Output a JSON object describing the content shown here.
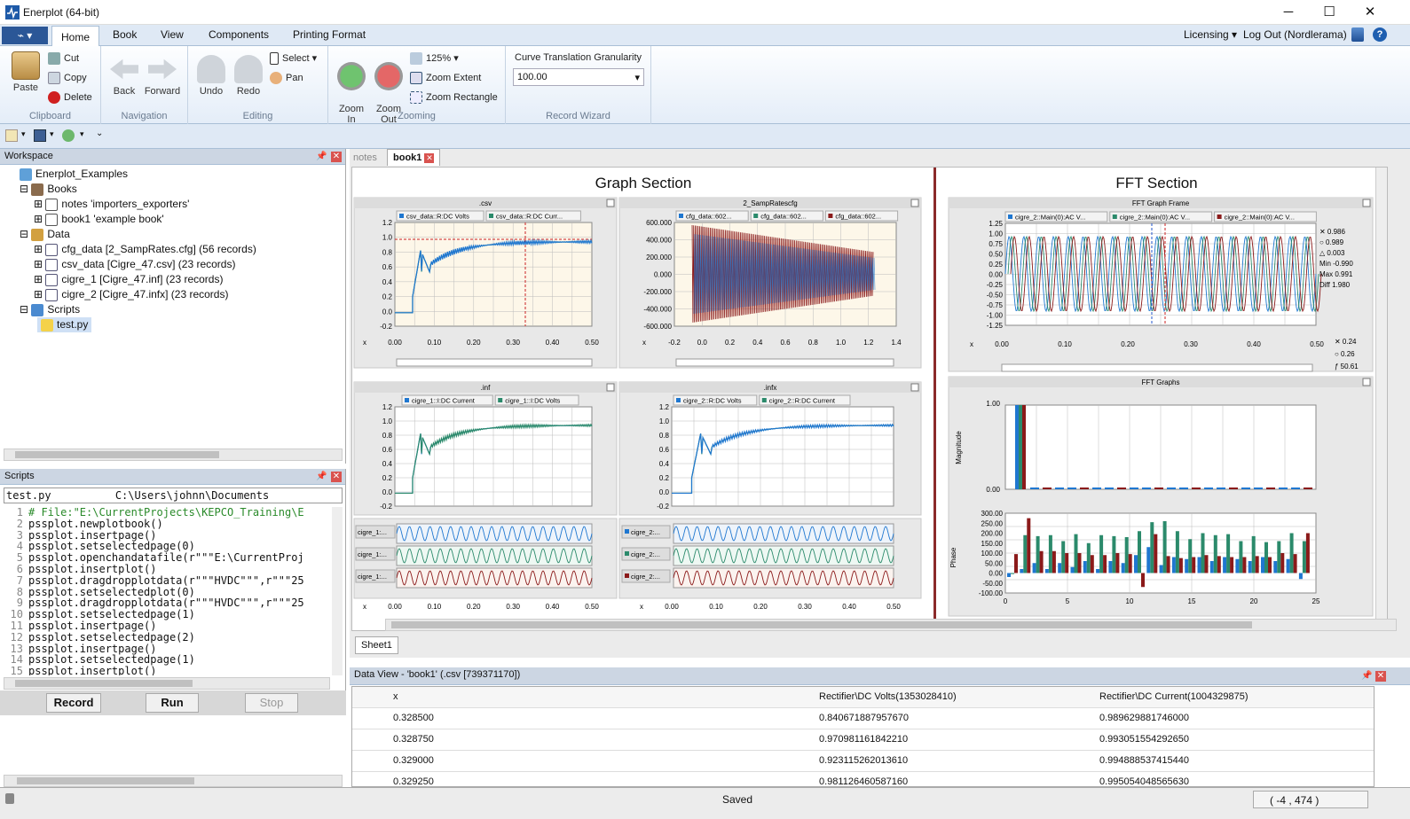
{
  "window": {
    "title": "Enerplot (64-bit)"
  },
  "ribbon": {
    "tabs": [
      "Home",
      "Book",
      "View",
      "Components",
      "Printing Format"
    ],
    "right": {
      "licensing": "Licensing",
      "logout": "Log Out (Nordlerama)"
    },
    "clipboard": {
      "paste": "Paste",
      "cut": "Cut",
      "copy": "Copy",
      "delete": "Delete",
      "label": "Clipboard"
    },
    "navigation": {
      "back": "Back",
      "forward": "Forward",
      "label": "Navigation"
    },
    "editing": {
      "undo": "Undo",
      "redo": "Redo",
      "select": "Select",
      "pan": "Pan",
      "label": "Editing"
    },
    "zooming": {
      "zoom_in": "Zoom\nIn",
      "zoom_out": "Zoom\nOut",
      "percent": "125%",
      "extent": "Zoom Extent",
      "rect": "Zoom Rectangle",
      "label": "Zooming"
    },
    "record": {
      "title": "Curve Translation Granularity",
      "value": "100.00",
      "label": "Record Wizard"
    }
  },
  "workspace": {
    "header": "Workspace",
    "root": "Enerplot_Examples",
    "books": "Books",
    "notes": "notes 'importers_exporters'",
    "book1": "book1 'example book'",
    "data": "Data",
    "d1": "cfg_data [2_SampRates.cfg] (56 records)",
    "d2": "csv_data [Cigre_47.csv] (23 records)",
    "d3": "cigre_1 [Cigre_47.inf] (23 records)",
    "d4": "cigre_2 [Cigre_47.infx] (23 records)",
    "scripts": "Scripts",
    "testpy": "test.py"
  },
  "scripts": {
    "header": "Scripts",
    "file": "test.py",
    "path": "C:\\Users\\johnn\\Documents",
    "lines": [
      "# File:\"E:\\CurrentProjects\\KEPCO_Training\\E",
      "pssplot.newplotbook()",
      "pssplot.insertpage()",
      "pssplot.setselectedpage(0)",
      "pssplot.openchandatafile(r\"\"\"E:\\CurrentProj",
      "pssplot.insertplot()",
      "pssplot.dragdropplotdata(r\"\"\"HVDC\"\"\",r\"\"\"25",
      "pssplot.setselectedplot(0)",
      "pssplot.dragdropplotdata(r\"\"\"HVDC\"\"\",r\"\"\"25",
      "pssplot.setselectedpage(1)",
      "pssplot.insertpage()",
      "pssplot.setselectedpage(2)",
      "pssplot.insertpage()",
      "pssplot.setselectedpage(1)",
      "pssplot.insertplot()"
    ],
    "record": "Record",
    "run": "Run",
    "stop": "Stop"
  },
  "book": {
    "tabs": [
      "notes",
      "book1"
    ],
    "graph_section": "Graph Section",
    "fft_section": "FFT Section",
    "sheet": "Sheet1",
    "plots": {
      "csv": {
        "title": ".csv",
        "legend": [
          "csv_data::R:DC Volts",
          "csv_data::R:DC Curr..."
        ]
      },
      "cfg": {
        "title": "2_SampRatescfg",
        "legend": [
          "cfg_data::602...",
          "cfg_data::602...",
          "cfg_data::602..."
        ]
      },
      "inf": {
        "title": ".inf",
        "legend": [
          "cigre_1::I:DC Current",
          "cigre_1::I:DC Volts"
        ]
      },
      "infx": {
        "title": ".infx",
        "legend": [
          "cigre_2::R:DC Volts",
          "cigre_2::R:DC Current"
        ]
      },
      "fft": {
        "title": "FFT Graph Frame",
        "legend": [
          "cigre_2::Main(0):AC V...",
          "cigre_2::Main(0):AC V...",
          "cigre_2::Main(0):AC V..."
        ]
      },
      "fftg": {
        "title": "FFT Graphs",
        "mag": "Magnitude",
        "phase": "Phase"
      },
      "mini_left": [
        "cigre_1:...",
        "cigre_1:...",
        "cigre_1:..."
      ],
      "mini_right": [
        "cigre_2:...",
        "cigre_2:...",
        "cigre_2:..."
      ]
    },
    "fft_readout": {
      "x1": "0.986",
      "o1": "0.989",
      "d1": "0.003",
      "min": "Min -0.990",
      "max": "Max 0.991",
      "diff": "Diff 1.980",
      "x2": "0.24",
      "o2": "0.26",
      "f": "50.61"
    }
  },
  "dataview": {
    "header": "Data View - 'book1' (.csv [739371170])",
    "cols": [
      "x",
      "Rectifier\\DC Volts(1353028410)",
      "Rectifier\\DC Current(1004329875)"
    ],
    "rows": [
      [
        "0.328500",
        "0.840671887957670",
        "0.989629881746000"
      ],
      [
        "0.328750",
        "0.970981161842210",
        "0.993051554292650"
      ],
      [
        "0.329000",
        "0.923115262013610",
        "0.994888537415440"
      ],
      [
        "0.329250",
        "0.981126460587160",
        "0.995054048565630"
      ]
    ]
  },
  "status": {
    "saved": "Saved",
    "coords": "( -4 , 474 )"
  }
}
